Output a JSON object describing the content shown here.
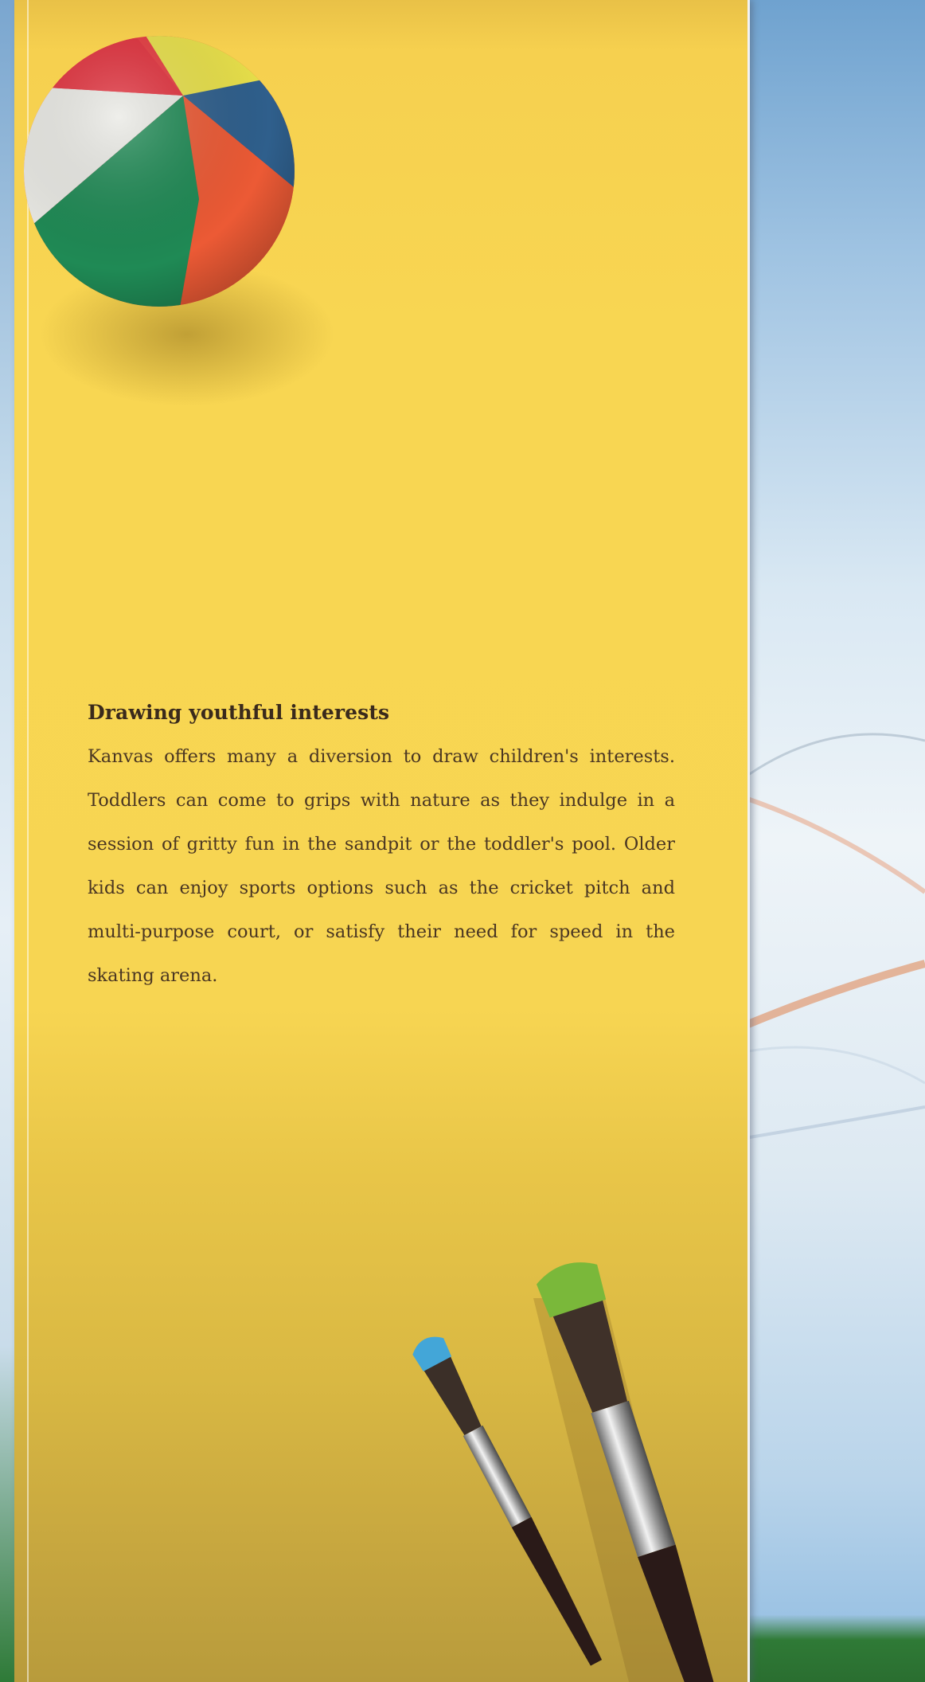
{
  "article": {
    "heading": "Drawing youthful interests",
    "body": "Kanvas offers many a diversion to draw children's interests. Toddlers can come to grips with nature as they indulge in a session of gritty fun in the sandpit or the toddler's pool. Older kids can enjoy sports options such as the cricket pitch and multi-purpose court, or satisfy their need for speed in the skating arena."
  },
  "colors": {
    "panel_yellow": "#f7d552",
    "text_brown": "#4a3622",
    "sky_blue": "#9fc3e2",
    "grass_green": "#2f7a36"
  },
  "images": {
    "top_left": "beach-ball",
    "bottom_right": "paint-brushes"
  }
}
